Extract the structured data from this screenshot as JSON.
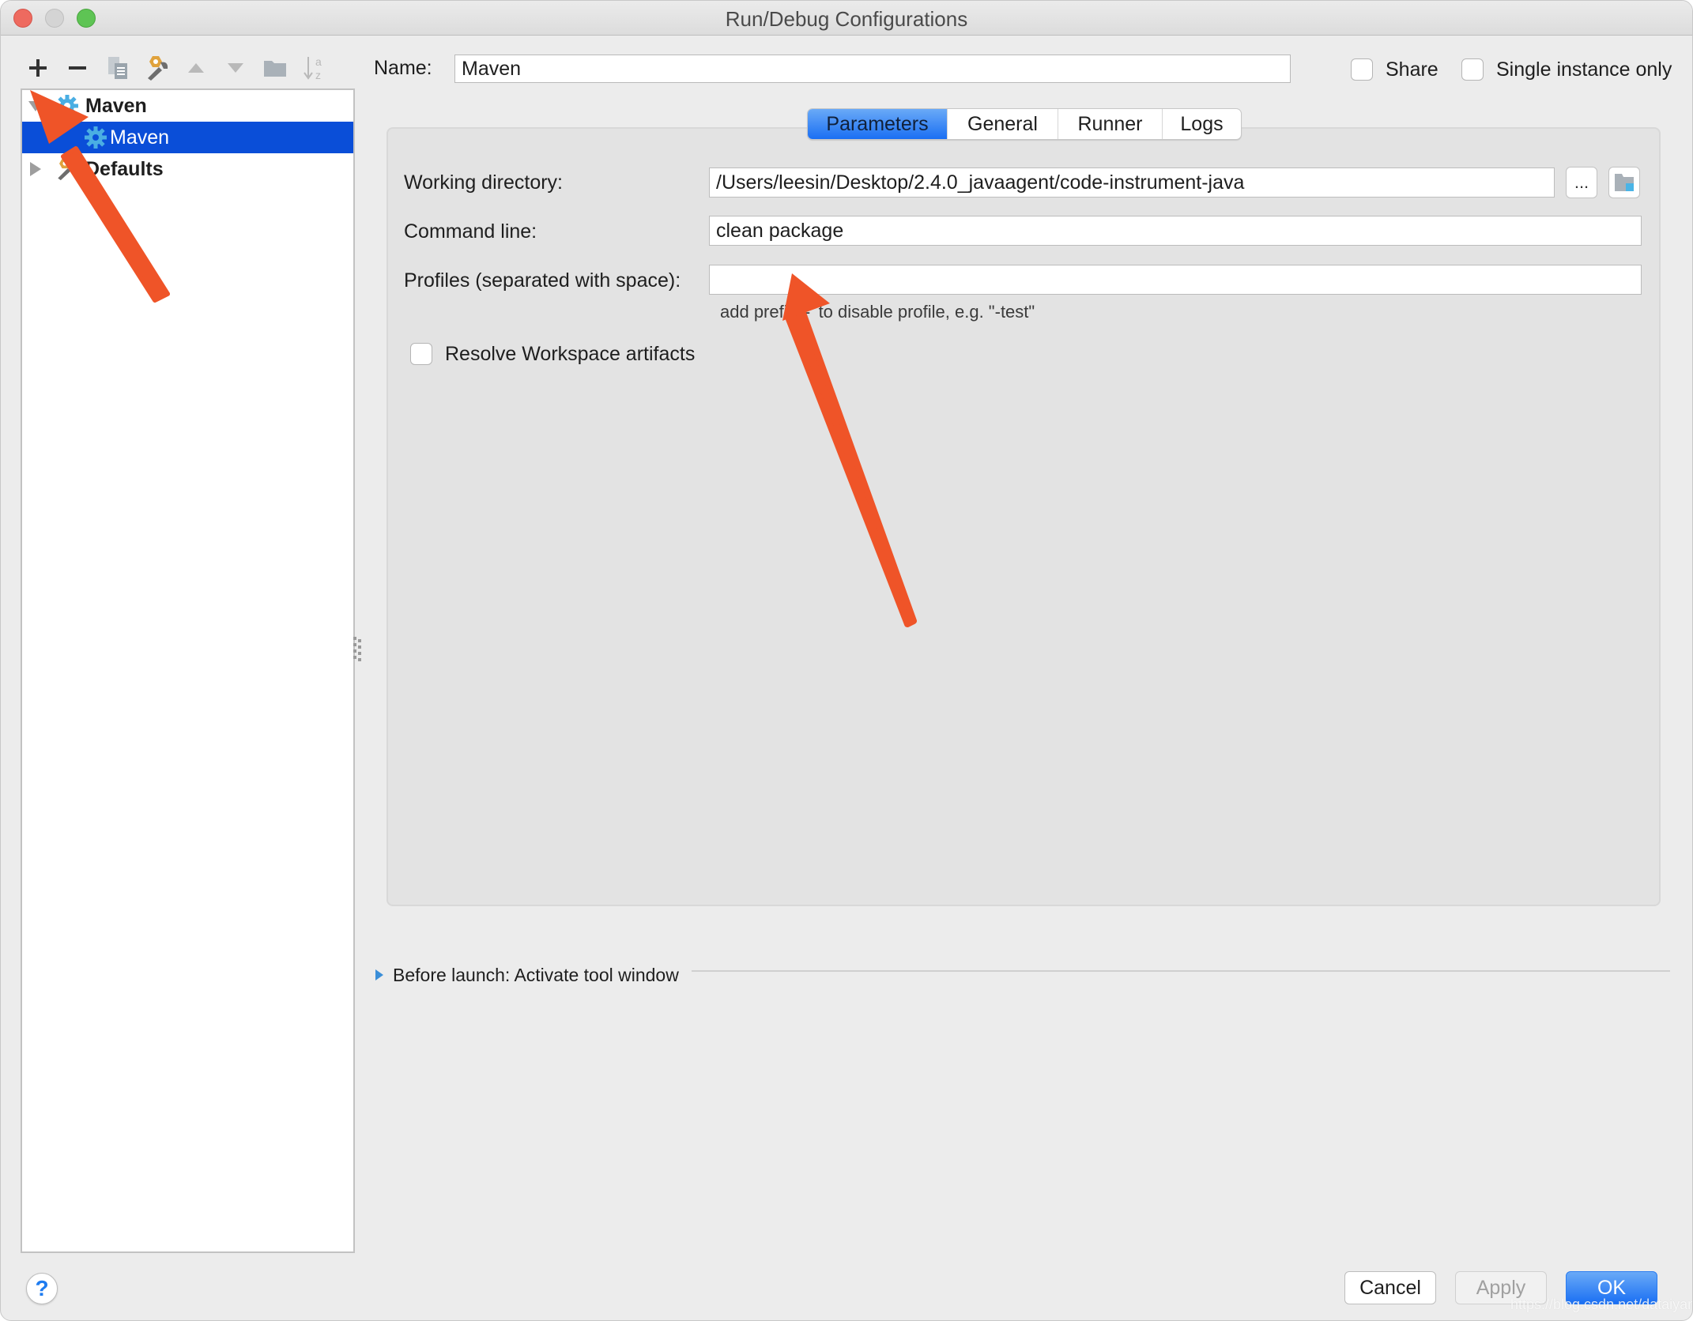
{
  "window": {
    "title": "Run/Debug Configurations"
  },
  "toolbar": {
    "items": [
      {
        "name": "add",
        "icon": "plus-icon"
      },
      {
        "name": "remove",
        "icon": "minus-icon"
      },
      {
        "name": "copy",
        "icon": "copy-icon"
      },
      {
        "name": "edit-defaults",
        "icon": "wrench-icon"
      },
      {
        "name": "move-up",
        "icon": "arrow-up-icon"
      },
      {
        "name": "move-down",
        "icon": "arrow-down-icon"
      },
      {
        "name": "folder",
        "icon": "folder-icon"
      },
      {
        "name": "sort",
        "icon": "sort-alpha-icon"
      }
    ]
  },
  "tree": {
    "items": [
      {
        "label": "Maven",
        "level": 0,
        "expanded": true,
        "icon": "gear-icon"
      },
      {
        "label": "Maven",
        "level": 1,
        "selected": true,
        "icon": "gear-icon"
      },
      {
        "label": "Defaults",
        "level": 0,
        "expanded": false,
        "icon": "wrench-icon"
      }
    ]
  },
  "config": {
    "name_label": "Name:",
    "name_value": "Maven",
    "share_label": "Share",
    "share_checked": false,
    "single_instance_label": "Single instance only",
    "single_instance_checked": false
  },
  "tabs": [
    {
      "label": "Parameters",
      "active": true
    },
    {
      "label": "General",
      "active": false
    },
    {
      "label": "Runner",
      "active": false
    },
    {
      "label": "Logs",
      "active": false
    }
  ],
  "parameters": {
    "working_dir_label": "Working directory:",
    "working_dir_value": "/Users/leesin/Desktop/2.4.0_javaagent/code-instrument-java",
    "browse_label": "...",
    "command_line_label": "Command line:",
    "command_line_value": "clean package",
    "profiles_label": "Profiles (separated with space):",
    "profiles_value": "",
    "profiles_hint": "add prefix '-' to disable profile, e.g. \"-test\"",
    "resolve_label": "Resolve Workspace artifacts",
    "resolve_checked": false
  },
  "before_launch": {
    "label": "Before launch: Activate tool window"
  },
  "footer": {
    "help_label": "?",
    "cancel_label": "Cancel",
    "apply_label": "Apply",
    "ok_label": "OK"
  },
  "watermark": "https://blog.csdn.net/dataiyangu",
  "colors": {
    "selection": "#0a4ed8",
    "accent_blue": "#1a6ff3",
    "annotation_arrow": "#ef5428"
  }
}
